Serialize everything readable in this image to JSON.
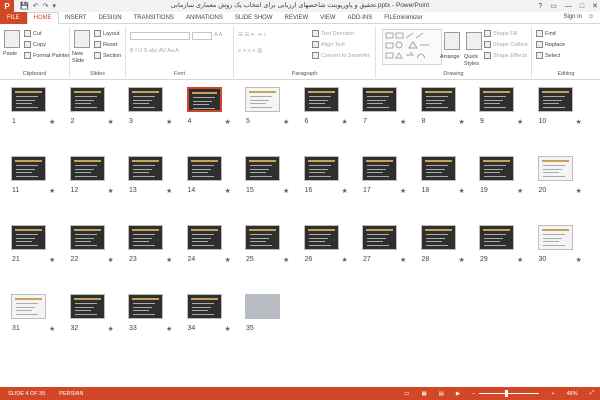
{
  "window": {
    "title": "تحقیق و پاورپوینت شاخصهای ارزیابی برای انتخاب یک روش معماری سازمانی.pptx - PowerPoint",
    "app_icon": "P",
    "controls": [
      "?",
      "▭",
      "—",
      "□",
      "✕"
    ]
  },
  "qat": [
    "💾",
    "↶",
    "↷",
    "▾"
  ],
  "tabs": [
    "FILE",
    "HOME",
    "INSERT",
    "DESIGN",
    "TRANSITIONS",
    "ANIMATIONS",
    "SLIDE SHOW",
    "REVIEW",
    "VIEW",
    "ADD-INS",
    "FILEminimizer"
  ],
  "active_tab": "HOME",
  "signin": "Sign in",
  "ribbon": {
    "clipboard": {
      "label": "Clipboard",
      "paste": "Paste",
      "cut": "Cut",
      "copy": "Copy",
      "format_painter": "Format Painter"
    },
    "slides": {
      "label": "Slides",
      "new_slide": "New Slide",
      "layout": "Layout",
      "reset": "Reset",
      "section": "Section"
    },
    "font": {
      "label": "Font"
    },
    "paragraph": {
      "label": "Paragraph",
      "text_direction": "Text Direction",
      "align_text": "Align Text",
      "convert_smartart": "Convert to SmartArt"
    },
    "drawing": {
      "label": "Drawing",
      "arrange": "Arrange",
      "quick_styles": "Quick Styles",
      "shape_fill": "Shape Fill",
      "shape_outline": "Shape Outline",
      "shape_effects": "Shape Effects"
    },
    "editing": {
      "label": "Editing",
      "find": "Find",
      "replace": "Replace",
      "select": "Select"
    }
  },
  "slides": {
    "count": 35,
    "selected": 4,
    "numbers": [
      "1",
      "2",
      "3",
      "4",
      "5",
      "6",
      "7",
      "8",
      "9",
      "10",
      "11",
      "12",
      "13",
      "14",
      "15",
      "16",
      "17",
      "18",
      "19",
      "20",
      "21",
      "22",
      "23",
      "24",
      "25",
      "26",
      "27",
      "28",
      "29",
      "30",
      "31",
      "32",
      "33",
      "34",
      "35"
    ],
    "star": "★"
  },
  "status": {
    "slide_of": "SLIDE 4 OF 35",
    "language": "PERSIAN",
    "zoom": "48%"
  }
}
